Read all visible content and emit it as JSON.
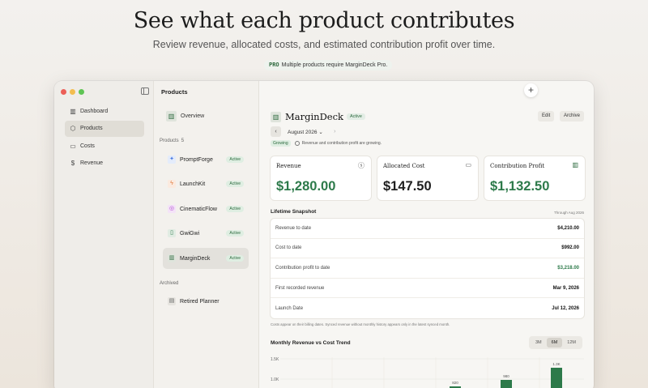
{
  "hero": {
    "title": "See what each product contributes",
    "subtitle": "Review revenue, allocated costs, and estimated contribution profit over time.",
    "pro_tag": "PRO",
    "pro_text": "Multiple products require MarginDeck Pro."
  },
  "sidebar": {
    "items": [
      {
        "label": "Dashboard",
        "icon": "bar-chart-icon",
        "active": false
      },
      {
        "label": "Products",
        "icon": "box-icon",
        "active": true
      },
      {
        "label": "Costs",
        "icon": "card-icon",
        "active": false
      },
      {
        "label": "Revenue",
        "icon": "dollar-icon",
        "active": false
      }
    ]
  },
  "products_column": {
    "title": "Products",
    "overview_label": "Overview",
    "section_label": "Products",
    "count": "5",
    "items": [
      {
        "name": "PromptForge",
        "status": "Active",
        "icon_color": "#4c7be0"
      },
      {
        "name": "LaunchKit",
        "status": "Active",
        "icon_color": "#e07a3c"
      },
      {
        "name": "CinematicFlow",
        "status": "Active",
        "icon_color": "#b24cd0"
      },
      {
        "name": "GwiGwi",
        "status": "Active",
        "icon_color": "#2d7a4a"
      },
      {
        "name": "MarginDeck",
        "status": "Active",
        "icon_color": "#2d7a4a"
      }
    ],
    "archived_label": "Archived",
    "archived_items": [
      {
        "name": "Retired Planner"
      }
    ]
  },
  "main": {
    "app_name": "MarginDeck",
    "app_status": "Active",
    "edit_label": "Edit",
    "archive_label": "Archive",
    "month": "August 2026",
    "trend_tag": "Growing",
    "trend_text": "Revenue and contribution profit are growing.",
    "cards": [
      {
        "title": "Revenue",
        "value": "$1,280.00",
        "icon": "dollar-icon"
      },
      {
        "title": "Allocated Cost",
        "value": "$147.50",
        "icon": "card-icon"
      },
      {
        "title": "Contribution Profit",
        "value": "$1,132.50",
        "icon": "bar-chart-icon"
      }
    ],
    "snapshot": {
      "title": "Lifetime Snapshot",
      "through": "Through Aug 2026",
      "rows": [
        {
          "label": "Revenue to date",
          "value": "$4,210.00"
        },
        {
          "label": "Cost to date",
          "value": "$992.00"
        },
        {
          "label": "Contribution profit to date",
          "value": "$3,218.00"
        },
        {
          "label": "First recorded revenue",
          "value": "Mar 9, 2026"
        },
        {
          "label": "Launch Date",
          "value": "Jul 12, 2026"
        }
      ]
    },
    "note": "Costs appear on their billing dates. Synced revenue without monthly history appears only in the latest synced month.",
    "trend_chart_title": "Monthly Revenue vs Cost Trend",
    "ranges": [
      "3M",
      "6M",
      "12M"
    ],
    "selected_range": "6M"
  },
  "chart_data": {
    "type": "bar",
    "title": "Monthly Revenue vs Cost Trend",
    "y_ticks": [
      "1.5K",
      "1.0K"
    ],
    "data_labels": [
      "820",
      "980",
      "1.3K"
    ],
    "values": [
      820,
      980,
      1280
    ],
    "ylim": [
      0,
      1500
    ],
    "colors": {
      "revenue": "#2d7a4a"
    }
  }
}
